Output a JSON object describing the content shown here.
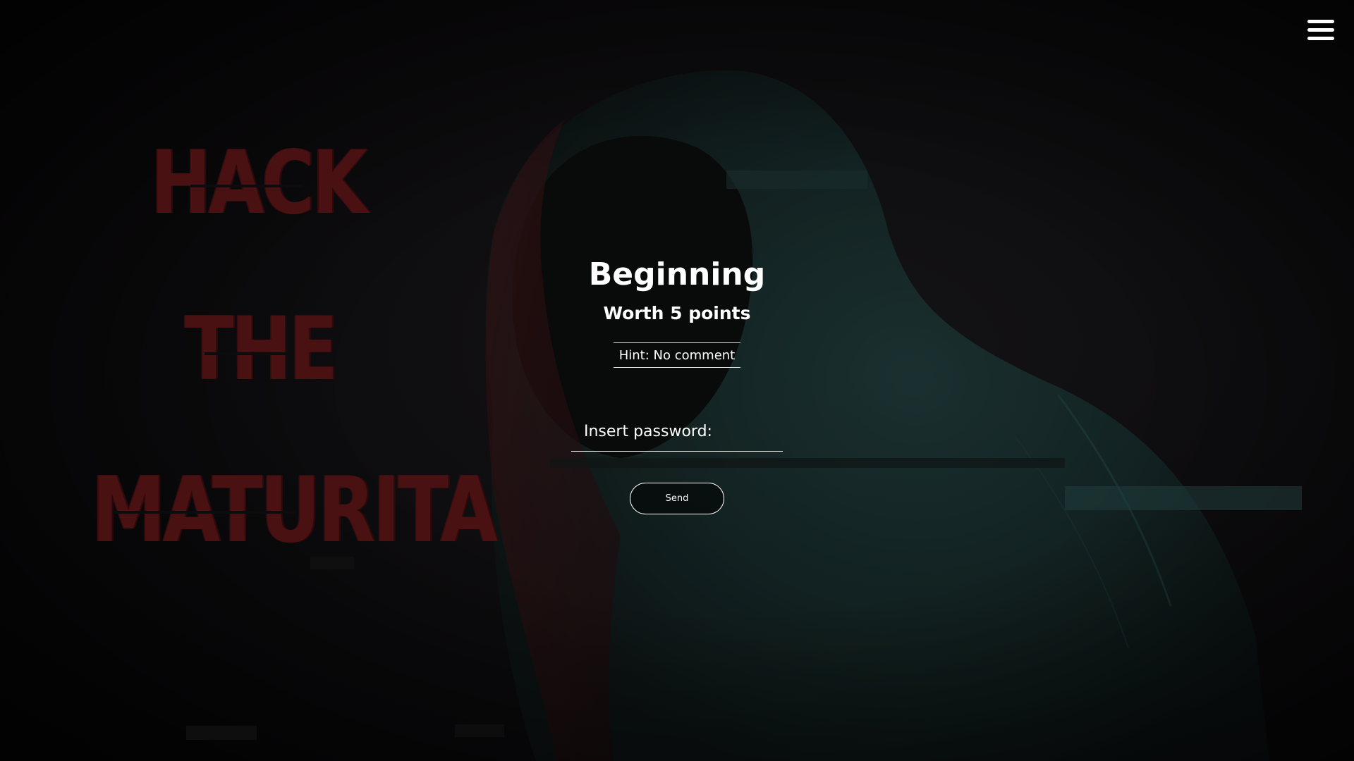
{
  "background": {
    "words": [
      "HACK",
      "THE",
      "MATURITA"
    ],
    "word_color": "#4a1113",
    "figure_color": "#1a3534"
  },
  "menu": {
    "icon": "hamburger-menu-icon"
  },
  "challenge": {
    "title": "Beginning",
    "points": "Worth 5 points",
    "hint": "Hint: No comment"
  },
  "form": {
    "password_placeholder": "Insert password:",
    "send_label": "Send"
  },
  "colors": {
    "background": "#0b0a0c",
    "text": "#ffffff",
    "accent_red": "#4a1113",
    "accent_teal": "#1a3534"
  }
}
